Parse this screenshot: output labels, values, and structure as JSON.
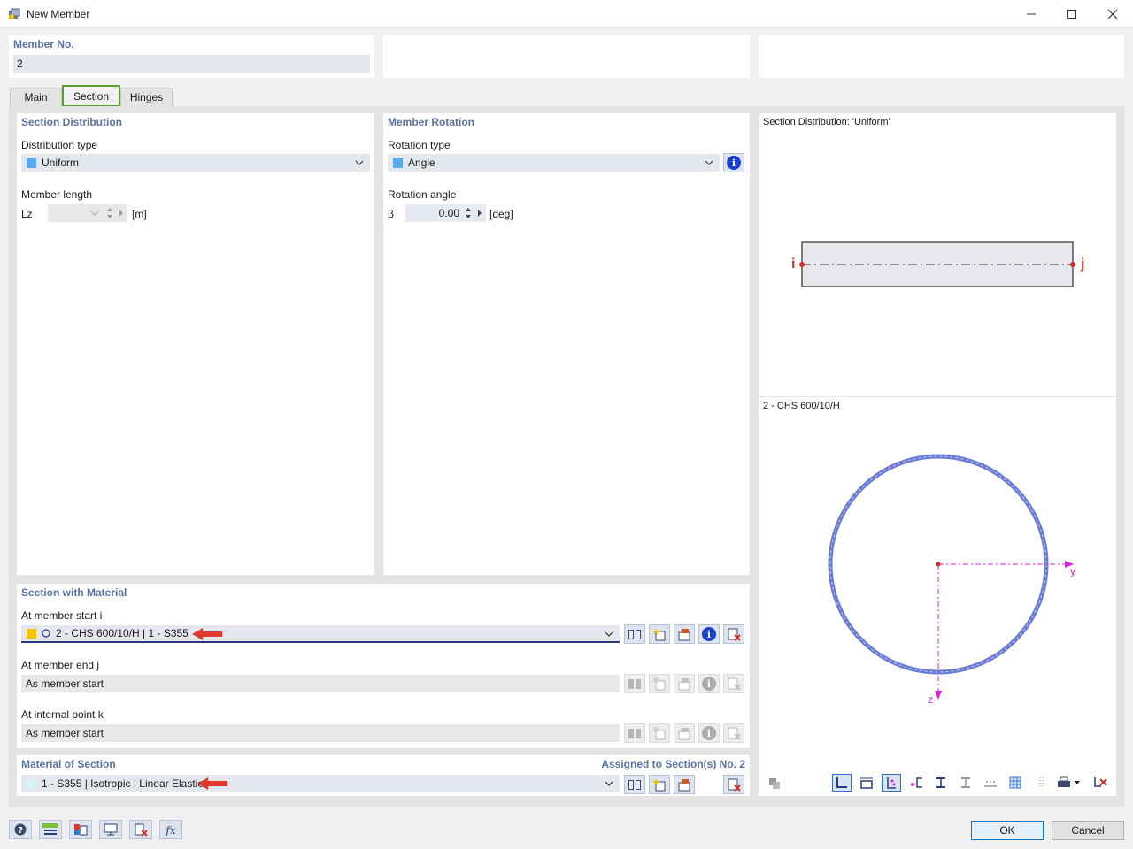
{
  "window": {
    "title": "New Member"
  },
  "member_no": {
    "label": "Member No.",
    "value": "2"
  },
  "tabs": [
    {
      "label": "Main"
    },
    {
      "label": "Section"
    },
    {
      "label": "Hinges"
    }
  ],
  "section_distribution": {
    "title": "Section Distribution",
    "distribution_type_label": "Distribution type",
    "distribution_type_value": "Uniform",
    "distribution_color": "#5aa8f0",
    "member_length_label": "Member length",
    "lz_symbol": "Lz",
    "lz_unit": "[m]"
  },
  "member_rotation": {
    "title": "Member Rotation",
    "rotation_type_label": "Rotation type",
    "rotation_type_value": "Angle",
    "rotation_color": "#5aa8f0",
    "rotation_angle_label": "Rotation angle",
    "beta_symbol": "β",
    "beta_value": "0.00",
    "beta_unit": "[deg]"
  },
  "section_with_material": {
    "title": "Section with Material",
    "start_label": "At member start i",
    "start_value": "2 - CHS 600/10/H | 1 - S355",
    "start_color": "#f5c400",
    "end_label": "At member end j",
    "end_value": "As member start",
    "internal_label": "At internal point k",
    "internal_value": "As member start"
  },
  "material_of_section": {
    "title": "Material of Section",
    "assigned": "Assigned to Section(s) No. 2",
    "value": "1 - S355 | Isotropic | Linear Elastic",
    "color": "#d8f4fb"
  },
  "preview": {
    "distribution_title": "Section Distribution: 'Uniform'",
    "node_i": "i",
    "node_j": "j",
    "section_title": "2 - CHS 600/10/H",
    "axis_y": "y",
    "axis_z": "z"
  },
  "buttons": {
    "ok": "OK",
    "cancel": "Cancel",
    "info": "i"
  }
}
